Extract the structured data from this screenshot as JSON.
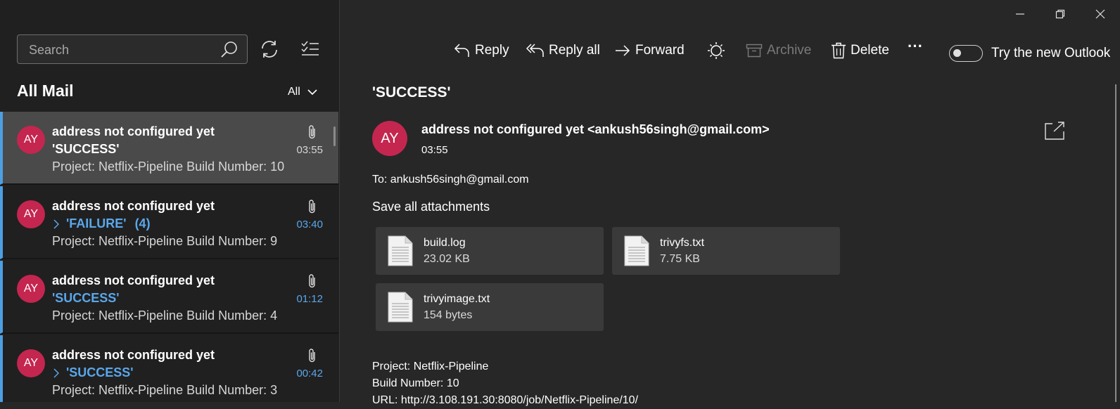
{
  "search": {
    "placeholder": "Search"
  },
  "folder": {
    "title": "All Mail",
    "filter_label": "All"
  },
  "mail_items": [
    {
      "avatar": "AY",
      "sender": "address not configured yet",
      "subject": "'SUCCESS'",
      "count": "",
      "preview": "Project: Netflix-Pipeline Build Number: 10",
      "time": "03:55"
    },
    {
      "avatar": "AY",
      "sender": "address not configured yet",
      "subject": "'FAILURE'",
      "count": "(4)",
      "preview": "Project: Netflix-Pipeline Build Number: 9",
      "time": "03:40"
    },
    {
      "avatar": "AY",
      "sender": "address not configured yet",
      "subject": "'SUCCESS'",
      "count": "",
      "preview": "Project: Netflix-Pipeline Build Number: 4",
      "time": "01:12"
    },
    {
      "avatar": "AY",
      "sender": "address not configured yet",
      "subject": "'SUCCESS'",
      "count": "",
      "preview": "Project: Netflix-Pipeline Build Number: 3",
      "time": "00:42"
    }
  ],
  "toolbar": {
    "reply": "Reply",
    "reply_all": "Reply all",
    "forward": "Forward",
    "archive": "Archive",
    "delete": "Delete",
    "more": "···",
    "try_new_outlook": "Try the new Outlook"
  },
  "message": {
    "subject": "'SUCCESS'",
    "avatar": "AY",
    "from": "address not configured yet <ankush56singh@gmail.com>",
    "time": "03:55",
    "to": "To: ankush56singh@gmail.com",
    "save_all": "Save all attachments",
    "attachments": [
      {
        "name": "build.log",
        "size": "23.02 KB"
      },
      {
        "name": "trivyfs.txt",
        "size": "7.75 KB"
      },
      {
        "name": "trivyimage.txt",
        "size": "154 bytes"
      }
    ],
    "body": [
      "Project: Netflix-Pipeline",
      "Build Number: 10",
      "URL: http://3.108.191.30:8080/job/Netflix-Pipeline/10/"
    ]
  },
  "colors": {
    "accent_blue": "#5aa7ea",
    "avatar_red": "#c4264f",
    "selected_bg": "#4a4a4a"
  }
}
